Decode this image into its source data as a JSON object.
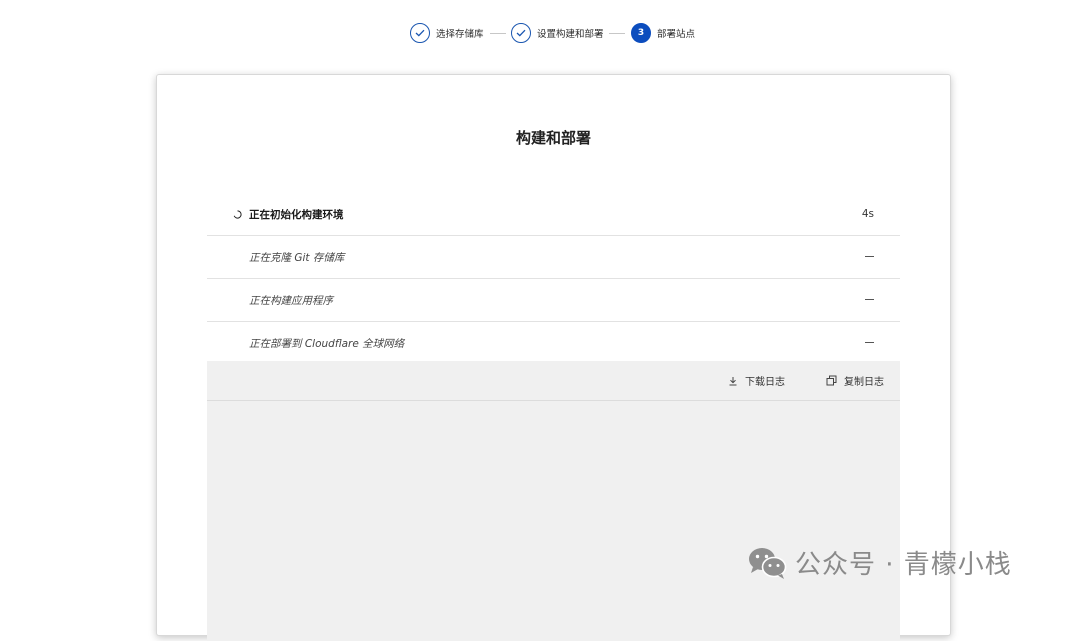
{
  "stepper": {
    "steps": [
      {
        "label": "选择存储库",
        "status": "done",
        "icon": "check-icon"
      },
      {
        "label": "设置构建和部署",
        "status": "done",
        "icon": "check-icon"
      },
      {
        "label": "部署站点",
        "status": "active",
        "number": "3"
      }
    ]
  },
  "card": {
    "title": "构建和部署",
    "steps": [
      {
        "label": "正在初始化构建环境",
        "status": "in-progress",
        "time": "4s",
        "icon": "spinner-icon"
      },
      {
        "label": "正在克隆 Git 存储库",
        "status": "pending",
        "time": "—"
      },
      {
        "label": "正在构建应用程序",
        "status": "pending",
        "time": "—"
      },
      {
        "label": "正在部署到 Cloudflare 全球网络",
        "status": "pending",
        "time": "—"
      }
    ],
    "log_toolbar": {
      "download_label": "下载日志",
      "download_icon": "download-icon",
      "copy_label": "复制日志",
      "copy_icon": "copy-icon"
    }
  },
  "watermark": {
    "icon": "wechat-icon",
    "text": "公众号 · 青檬小栈"
  },
  "colors": {
    "accent": "#0c4dbe",
    "log_bg": "#f0f0f0",
    "divider": "#e2e2e2"
  }
}
